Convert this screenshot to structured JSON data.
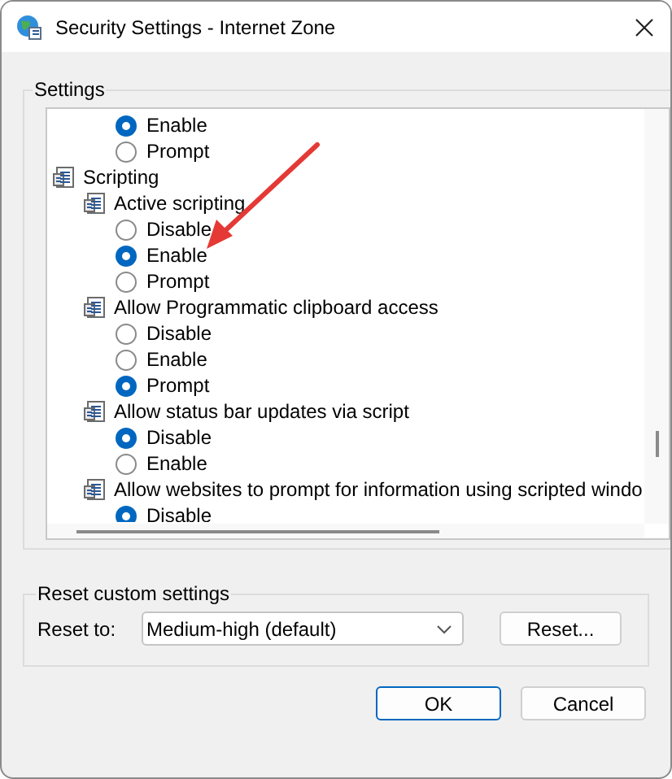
{
  "window": {
    "title": "Security Settings - Internet Zone"
  },
  "settings": {
    "label": "Settings",
    "tree": [
      {
        "kind": "option",
        "label": "Enable",
        "selected": true
      },
      {
        "kind": "option",
        "label": "Prompt",
        "selected": false
      },
      {
        "kind": "category",
        "label": "Scripting",
        "children": [
          {
            "kind": "setting",
            "label": "Active scripting",
            "children": [
              {
                "kind": "option",
                "label": "Disable",
                "selected": false
              },
              {
                "kind": "option",
                "label": "Enable",
                "selected": true
              },
              {
                "kind": "option",
                "label": "Prompt",
                "selected": false
              }
            ]
          },
          {
            "kind": "setting",
            "label": "Allow Programmatic clipboard access",
            "children": [
              {
                "kind": "option",
                "label": "Disable",
                "selected": false
              },
              {
                "kind": "option",
                "label": "Enable",
                "selected": false
              },
              {
                "kind": "option",
                "label": "Prompt",
                "selected": true
              }
            ]
          },
          {
            "kind": "setting",
            "label": "Allow status bar updates via script",
            "children": [
              {
                "kind": "option",
                "label": "Disable",
                "selected": true
              },
              {
                "kind": "option",
                "label": "Enable",
                "selected": false
              }
            ]
          },
          {
            "kind": "setting",
            "label": "Allow websites to prompt for information using scripted windo",
            "children": [
              {
                "kind": "option",
                "label": "Disable",
                "selected": true
              }
            ]
          }
        ]
      }
    ]
  },
  "reset": {
    "label": "Reset custom settings",
    "field_label": "Reset to:",
    "value": "Medium-high (default)",
    "button": "Reset..."
  },
  "buttons": [
    "OK",
    "Cancel"
  ]
}
